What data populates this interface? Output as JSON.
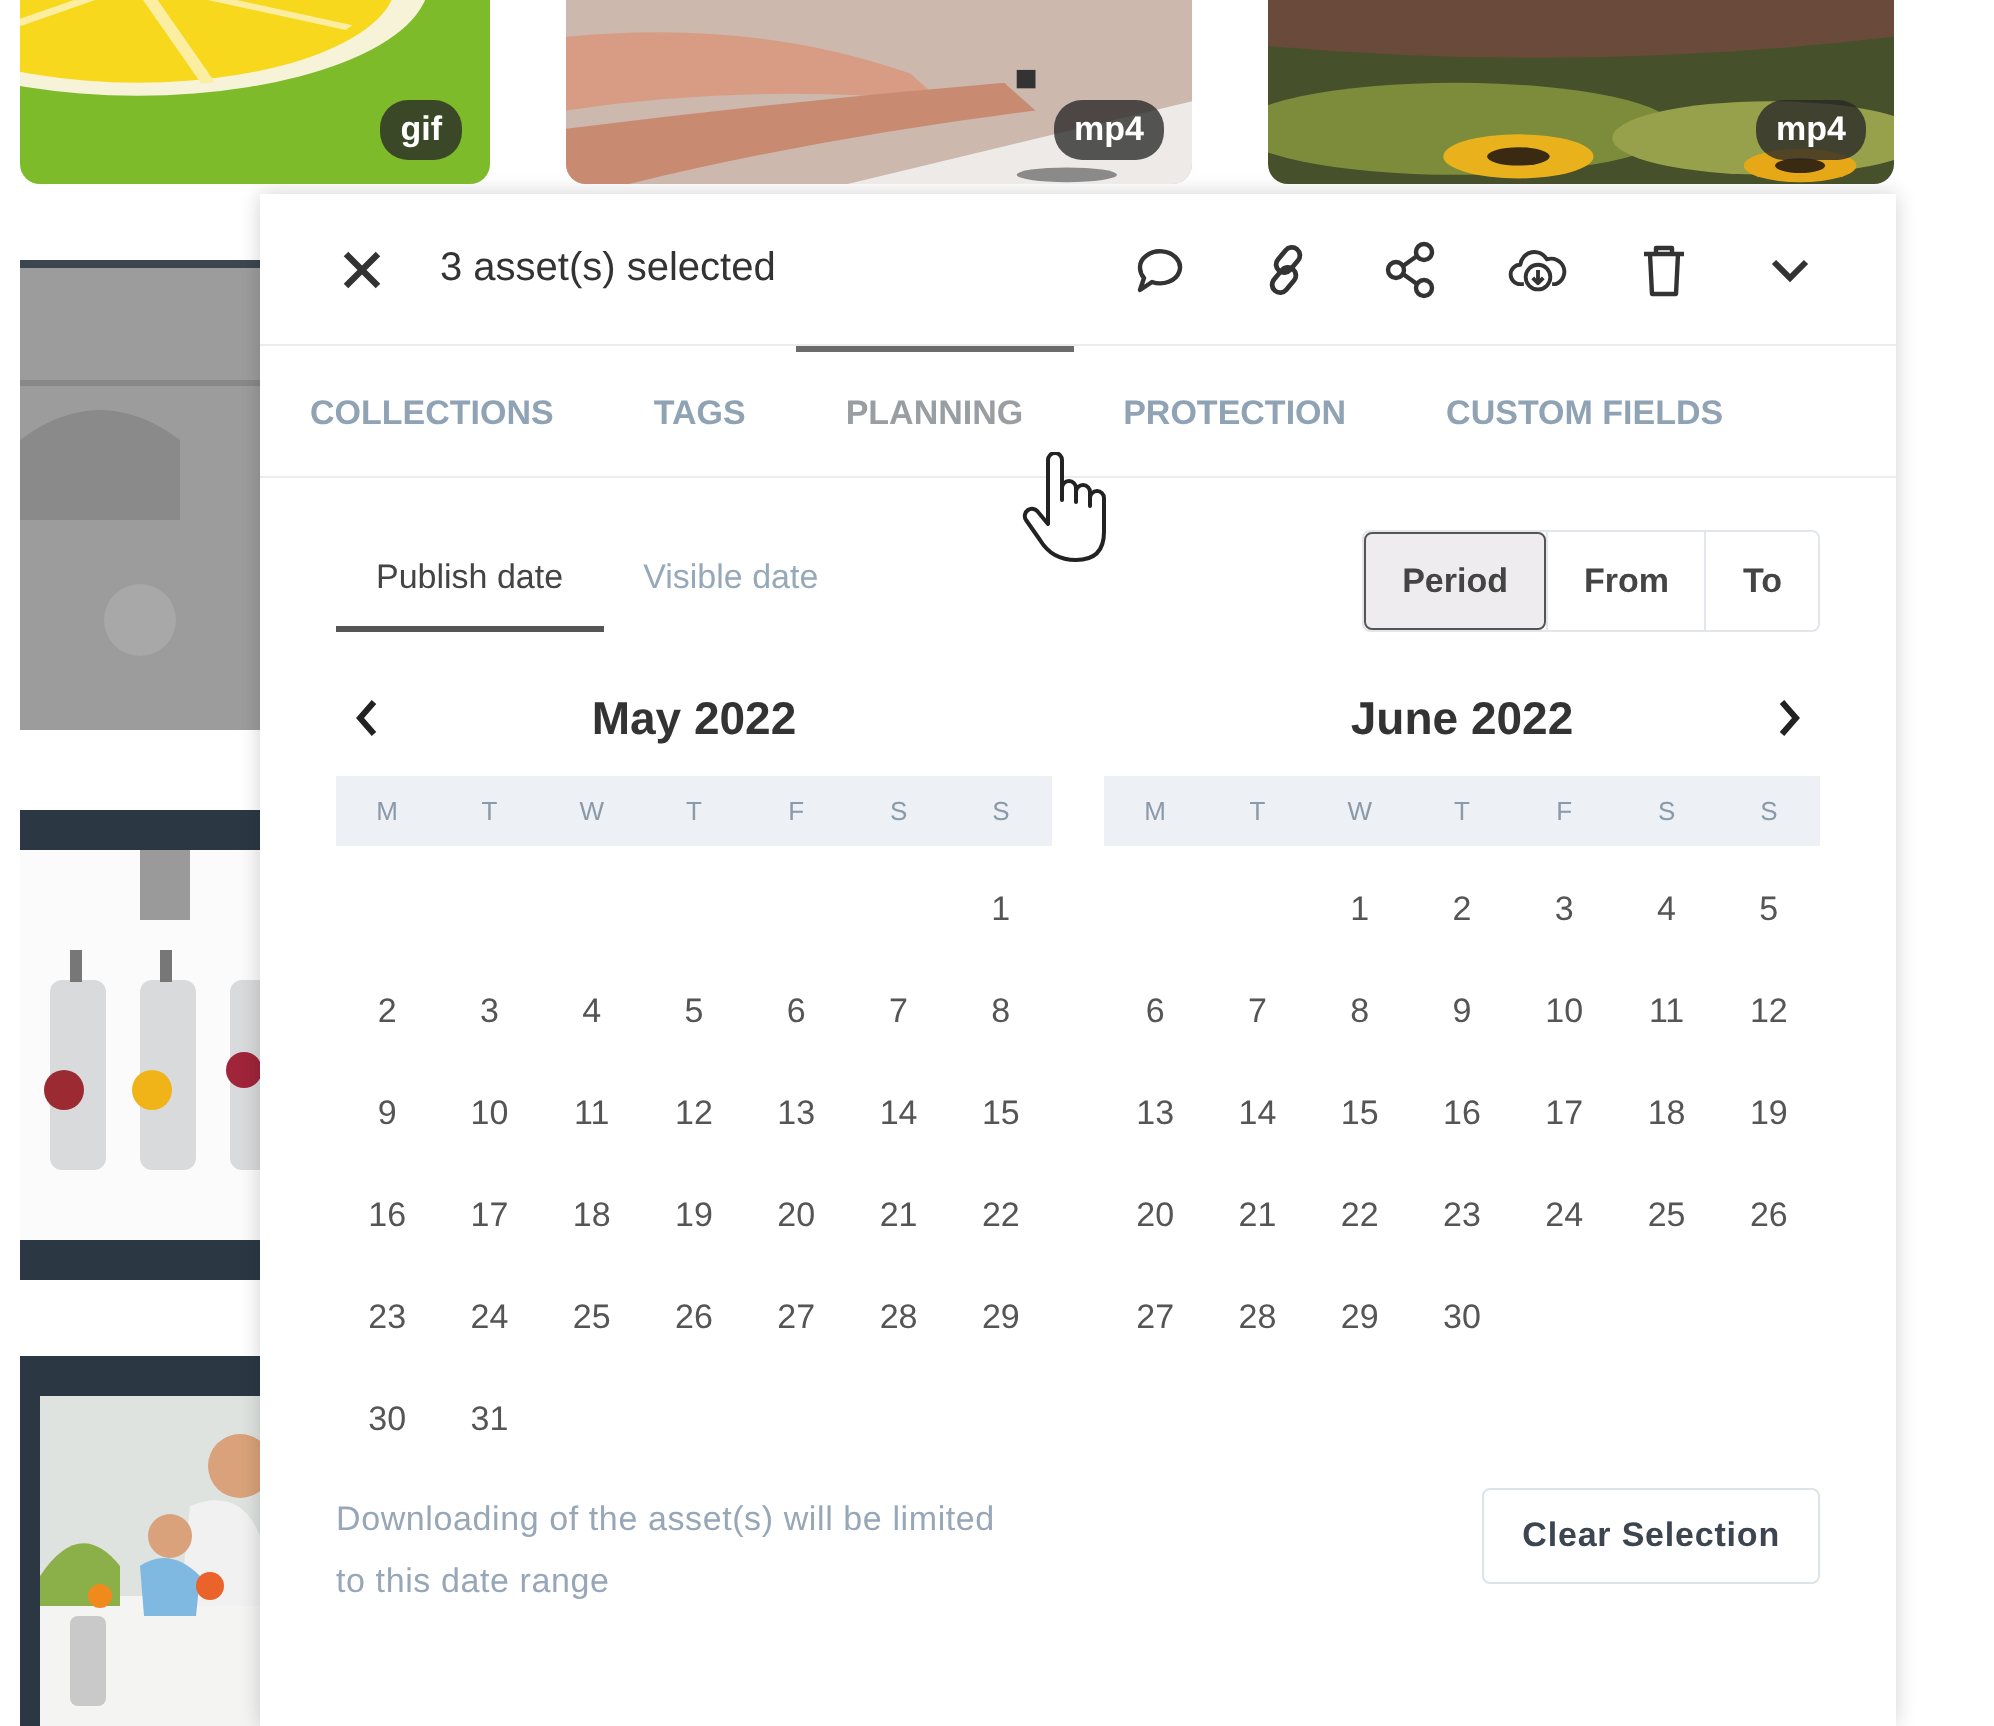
{
  "thumbnails": [
    {
      "badge": "gif",
      "kind": "lemon"
    },
    {
      "badge": "mp4",
      "kind": "hands"
    },
    {
      "badge": "mp4",
      "kind": "flowers"
    }
  ],
  "panel": {
    "title": "3 asset(s) selected",
    "tabs": [
      {
        "label": "COLLECTIONS",
        "selected": false
      },
      {
        "label": "TAGS",
        "selected": false
      },
      {
        "label": "PLANNING",
        "selected": true
      },
      {
        "label": "PROTECTION",
        "selected": false
      },
      {
        "label": "CUSTOM FIELDS",
        "selected": false
      }
    ],
    "date_tabs": [
      {
        "label": "Publish date",
        "selected": true
      },
      {
        "label": "Visible date",
        "selected": false
      }
    ],
    "range_modes": [
      {
        "label": "Period",
        "selected": true
      },
      {
        "label": "From",
        "selected": false
      },
      {
        "label": "To",
        "selected": false
      }
    ],
    "calendars": [
      {
        "title": "May 2022",
        "show_prev": true,
        "show_next": false,
        "weekdays": [
          "M",
          "T",
          "W",
          "T",
          "F",
          "S",
          "S"
        ],
        "weeks": [
          {
            "su": "1"
          },
          {
            "mo": "2",
            "tu": "3",
            "we": "4",
            "th": "5",
            "fr": "6",
            "sa": "7",
            "su": "8"
          },
          {
            "mo": "9",
            "tu": "10",
            "we": "11",
            "th": "12",
            "fr": "13",
            "sa": "14",
            "su": "15"
          },
          {
            "mo": "16",
            "tu": "17",
            "we": "18",
            "th": "19",
            "fr": "20",
            "sa": "21",
            "su": "22"
          },
          {
            "mo": "23",
            "tu": "24",
            "we": "25",
            "th": "26",
            "fr": "27",
            "sa": "28",
            "su": "29"
          },
          {
            "mo": "30",
            "tu": "31"
          }
        ]
      },
      {
        "title": "June 2022",
        "show_prev": false,
        "show_next": true,
        "weekdays": [
          "M",
          "T",
          "W",
          "T",
          "F",
          "S",
          "S"
        ],
        "weeks": [
          {
            "we": "1",
            "th": "2",
            "fr": "3",
            "sa": "4",
            "su": "5"
          },
          {
            "mo": "6",
            "tu": "7",
            "we": "8",
            "th": "9",
            "fr": "10",
            "sa": "11",
            "su": "12"
          },
          {
            "mo": "13",
            "tu": "14",
            "we": "15",
            "th": "16",
            "fr": "17",
            "sa": "18",
            "su": "19"
          },
          {
            "mo": "20",
            "tu": "21",
            "we": "22",
            "th": "23",
            "fr": "24",
            "sa": "25",
            "su": "26"
          },
          {
            "mo": "27",
            "tu": "28",
            "we": "29",
            "th": "30"
          }
        ]
      }
    ],
    "note": "Downloading of the asset(s) will be limited to this date range",
    "clear_button": "Clear Selection"
  }
}
